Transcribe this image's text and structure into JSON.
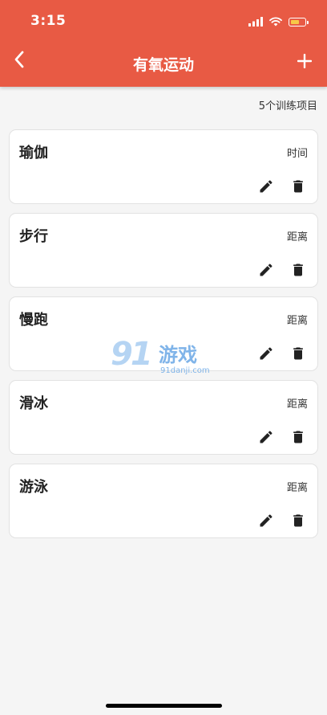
{
  "status_bar": {
    "time": "3:15"
  },
  "header": {
    "title": "有氧运动",
    "back_icon": "chevron-left-icon",
    "add_icon": "plus-icon"
  },
  "summary": {
    "count_label": "5个训练项目"
  },
  "exercises": [
    {
      "name": "瑜伽",
      "type": "时间"
    },
    {
      "name": "步行",
      "type": "距离"
    },
    {
      "name": "慢跑",
      "type": "距离"
    },
    {
      "name": "滑冰",
      "type": "距离"
    },
    {
      "name": "游泳",
      "type": "距离"
    }
  ],
  "watermark": {
    "logo_number": "91",
    "brand": "游戏",
    "site": "91danji.com"
  },
  "colors": {
    "primary": "#e85a44",
    "background": "#f5f5f5",
    "card": "#ffffff",
    "icon": "#222222"
  }
}
